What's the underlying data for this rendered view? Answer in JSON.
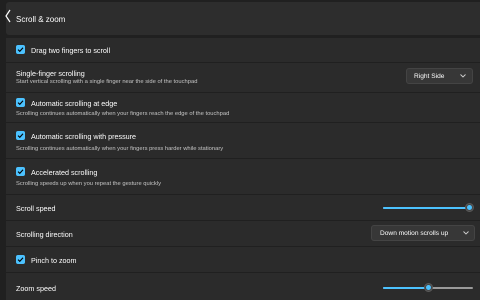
{
  "header": {
    "title": "Scroll & zoom",
    "back_icon": "chevron-back-icon"
  },
  "settings": {
    "drag_two_fingers": {
      "label": "Drag two fingers to scroll",
      "checked": true
    },
    "single_finger": {
      "title": "Single-finger scrolling",
      "description": "Start vertical scrolling with a single finger near the side of the touchpad",
      "value": "Right Side"
    },
    "auto_edge": {
      "title": "Automatic scrolling at edge",
      "description": "Scrolling continues automatically when your fingers reach the edge of the touchpad",
      "checked": true
    },
    "auto_pressure": {
      "title": "Automatic scrolling with pressure",
      "description": "Scrolling continues automatically when your fingers press harder while stationary",
      "checked": true
    },
    "accelerated": {
      "title": "Accelerated scrolling",
      "description": "Scrolling speeds up when you repeat the gesture quickly",
      "checked": true
    },
    "scroll_speed": {
      "label": "Scroll speed",
      "value": 1.0
    },
    "scroll_direction": {
      "label": "Scrolling direction",
      "value": "Down motion scrolls up"
    },
    "pinch_zoom": {
      "label": "Pinch to zoom",
      "checked": true
    },
    "zoom_speed": {
      "label": "Zoom speed",
      "value": 0.5
    }
  },
  "colors": {
    "accent": "#4cc2ff",
    "background": "#202020",
    "card": "#2b2b2b"
  }
}
